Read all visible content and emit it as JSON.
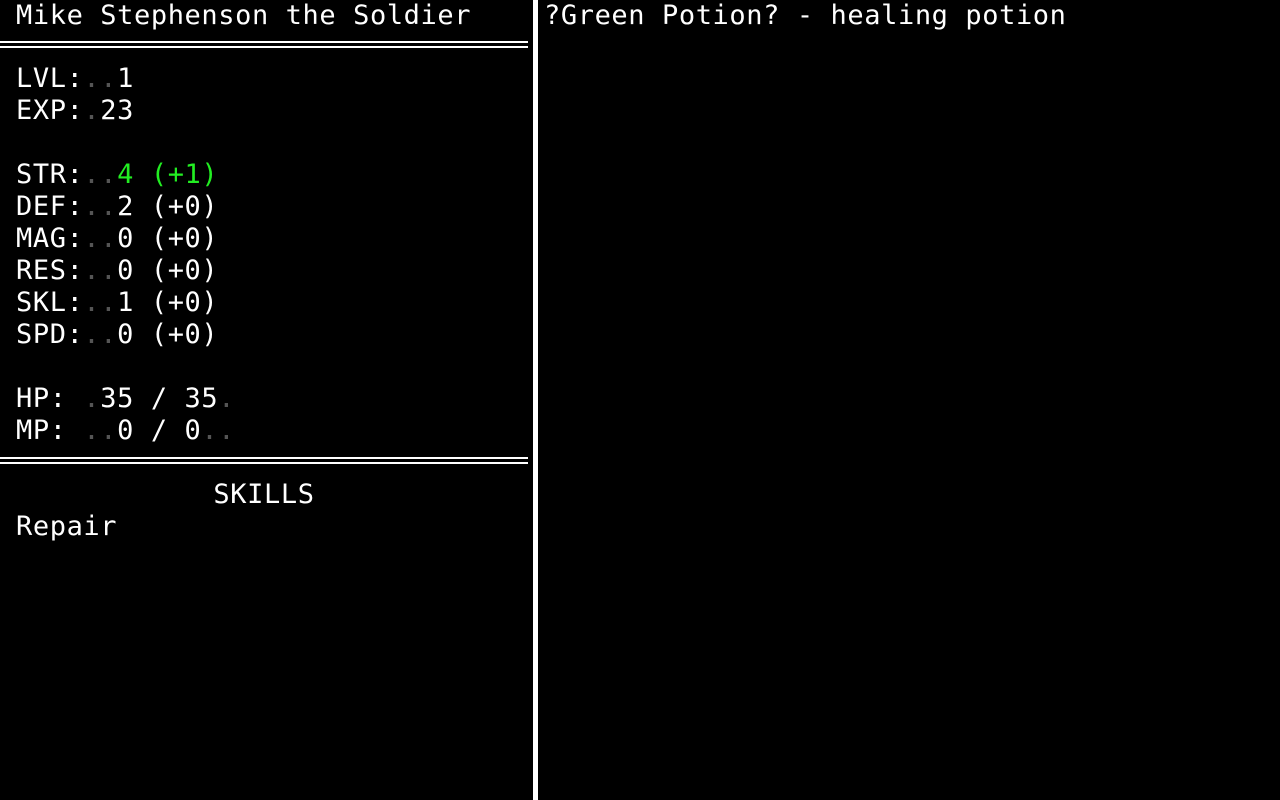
{
  "character": {
    "title": "Mike Stephenson the Soldier",
    "lvl": {
      "label": "LVL:",
      "pad": "..",
      "value": "1"
    },
    "exp": {
      "label": "EXP:",
      "pad": ".",
      "value": "23"
    },
    "stats": [
      {
        "label": "STR:",
        "pad": "..",
        "value": "4 (+1)",
        "color": "#22ee22"
      },
      {
        "label": "DEF:",
        "pad": "..",
        "value": "2 (+0)",
        "color": "#ffffff"
      },
      {
        "label": "MAG:",
        "pad": "..",
        "value": "0 (+0)",
        "color": "#ffffff"
      },
      {
        "label": "RES:",
        "pad": "..",
        "value": "0 (+0)",
        "color": "#ffffff"
      },
      {
        "label": "SKL:",
        "pad": "..",
        "value": "1 (+0)",
        "color": "#ffffff"
      },
      {
        "label": "SPD:",
        "pad": "..",
        "value": "0 (+0)",
        "color": "#ffffff"
      }
    ],
    "hp": {
      "label": "HP: ",
      "pad": ".",
      "value": "35 / 35",
      "pad_after": "."
    },
    "mp": {
      "label": "MP: ",
      "pad": "..",
      "value": "0 / 0",
      "pad_after": ".."
    }
  },
  "skills": {
    "heading": "SKILLS",
    "items": [
      "Repair"
    ]
  },
  "message_panel": {
    "text": "?Green Potion? - healing potion"
  },
  "colors": {
    "background": "#000000",
    "text": "#ffffff",
    "bonus": "#22ee22",
    "padding_dots": "#555555"
  }
}
